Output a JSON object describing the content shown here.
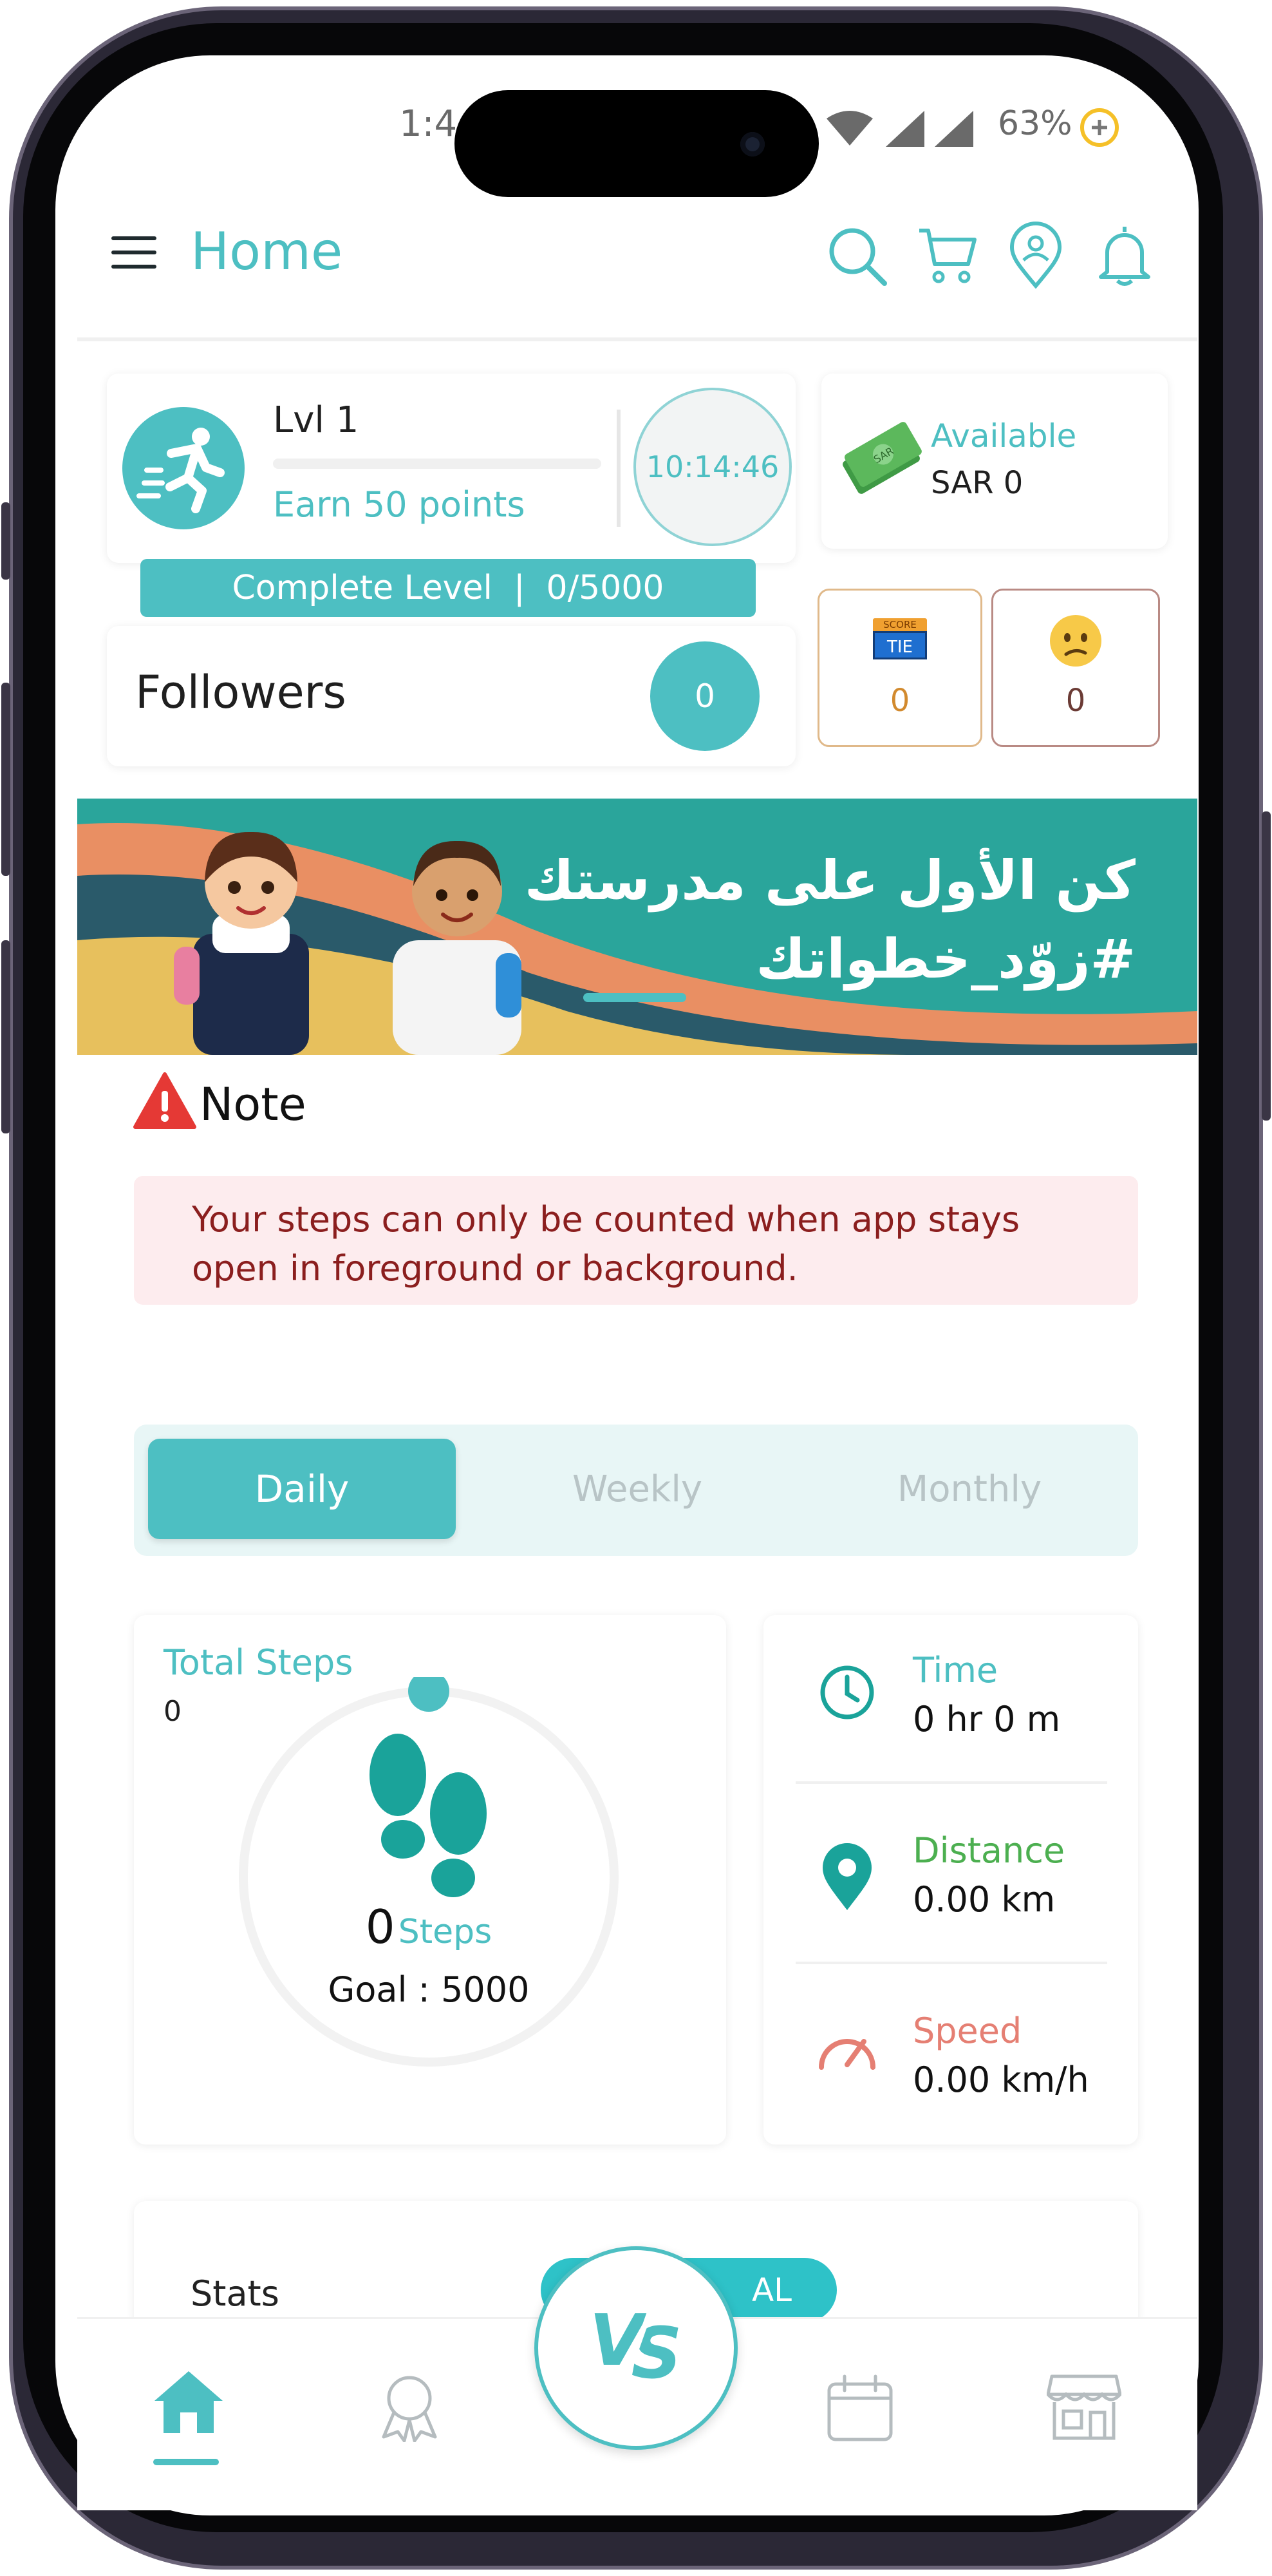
{
  "status_bar": {
    "time": "1:4",
    "battery": "63%"
  },
  "header": {
    "title": "Home"
  },
  "level": {
    "label": "Lvl 1",
    "progress": 0.0,
    "earn_text": "Earn 50 points",
    "timer": "10:14:46",
    "complete_label": "Complete Level  |  0/5000"
  },
  "wallet": {
    "label": "Available",
    "amount": "SAR 0"
  },
  "followers": {
    "label": "Followers",
    "count": "0"
  },
  "score_cards": [
    {
      "icon": "score-tie-icon",
      "badge_top": "SCORE",
      "badge": "TIE",
      "value": "0",
      "border": "#e0b98a"
    },
    {
      "icon": "sad-face-icon",
      "value": "0",
      "border": "#b98a84"
    }
  ],
  "banner": {
    "line1": "كن الأول على مدرستك",
    "line2": "#زوّد_خطواتك",
    "colors": [
      "#2aa59b",
      "#e98f63",
      "#e7c05d"
    ]
  },
  "note": {
    "title": "Note",
    "message": "Your steps can only be counted when app stays open in foreground or background."
  },
  "period_tabs": [
    {
      "label": "Daily",
      "active": true
    },
    {
      "label": "Weekly",
      "active": false
    },
    {
      "label": "Monthly",
      "active": false
    }
  ],
  "steps": {
    "title": "Total Steps",
    "total": "0",
    "count": "0",
    "unit": "Steps",
    "goal": "Goal : 5000",
    "progress": 0.0
  },
  "metrics": [
    {
      "label": "Time",
      "value": "0 hr 0 m",
      "icon": "clock-icon",
      "color": "#4dbfc2"
    },
    {
      "label": "Distance",
      "value": "0.00 km",
      "icon": "location-pin-icon",
      "color": "#4caf50"
    },
    {
      "label": "Speed",
      "value": "0.00 km/h",
      "icon": "speedometer-icon",
      "color": "#e57f73"
    }
  ],
  "stats": {
    "label": "Stats",
    "pill": "AL"
  },
  "bottom_nav": [
    {
      "name": "home",
      "icon": "home-icon",
      "active": true
    },
    {
      "name": "awards",
      "icon": "award-icon",
      "active": false
    },
    {
      "name": "vs",
      "icon": "vs-icon",
      "label": "VS",
      "active": false
    },
    {
      "name": "calendar",
      "icon": "calendar-icon",
      "active": false
    },
    {
      "name": "store",
      "icon": "store-icon",
      "active": false
    }
  ],
  "colors": {
    "accent": "#4dbfc2",
    "note_bg": "#fdecee",
    "note_text": "#8b1e1e",
    "warning": "#e53935"
  }
}
